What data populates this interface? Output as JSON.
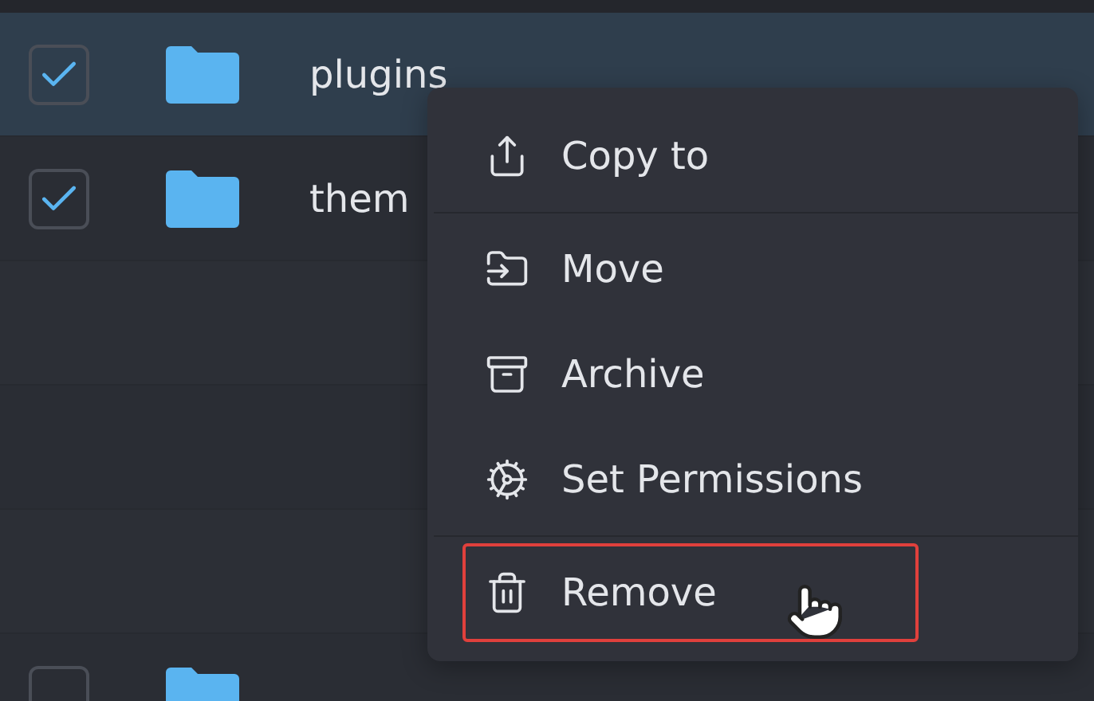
{
  "rows": [
    {
      "kind": "folder",
      "name": "plugins",
      "checked": true,
      "selected": true
    },
    {
      "kind": "folder",
      "name": "them",
      "checked": true,
      "selected": false
    },
    {
      "kind": "blank"
    },
    {
      "kind": "blank"
    },
    {
      "kind": "blank"
    },
    {
      "kind": "folder",
      "checked": false,
      "selected": false
    }
  ],
  "context_menu": {
    "items": [
      {
        "kind": "copy",
        "label": "Copy to",
        "divider_after": true,
        "hovered": false
      },
      {
        "kind": "move",
        "label": "Move",
        "divider_after": false,
        "hovered": false
      },
      {
        "kind": "archive",
        "label": "Archive",
        "divider_after": false,
        "hovered": false
      },
      {
        "kind": "permissions",
        "label": "Set Permissions",
        "divider_after": true,
        "hovered": false
      },
      {
        "kind": "remove",
        "label": "Remove",
        "divider_after": false,
        "hovered": true
      }
    ]
  }
}
